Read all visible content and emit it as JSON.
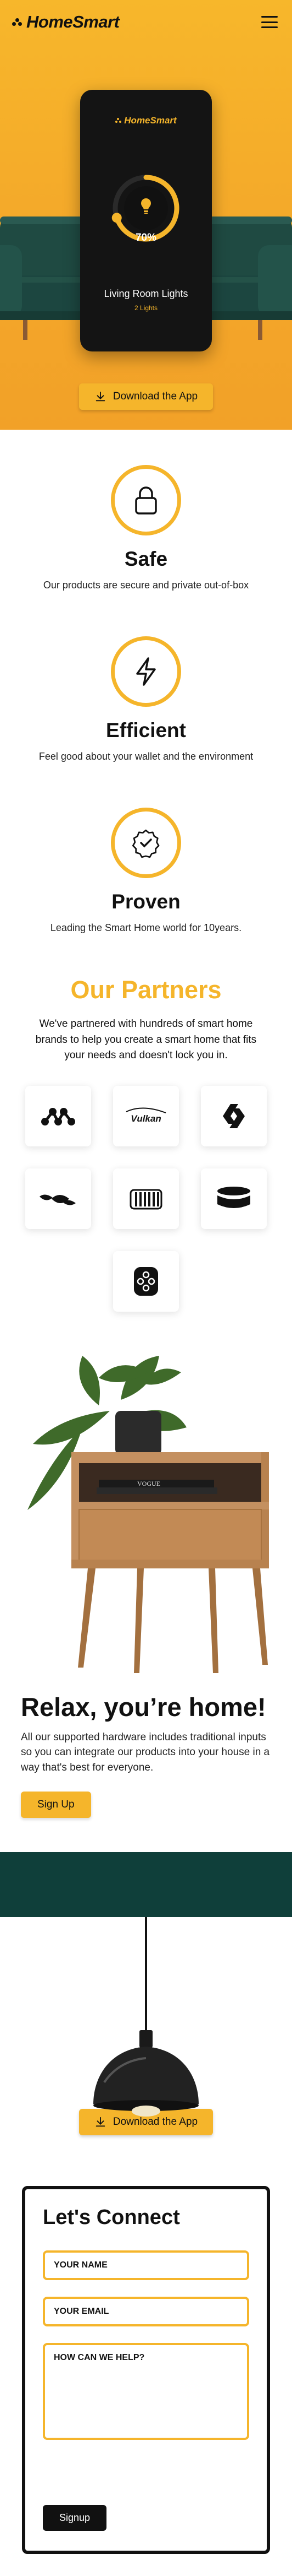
{
  "header": {
    "brand": "HomeSmart",
    "menu_icon": "hamburger-menu-icon"
  },
  "hero": {
    "phone_brand": "HomeSmart",
    "dial_percent": "70%",
    "dial_level": 0.7,
    "room_name": "Living Room Lights",
    "room_sub": "2 Lights"
  },
  "download": {
    "label": "Download the App",
    "icon": "download-icon"
  },
  "features": [
    {
      "title": "Safe",
      "desc": "Our products are secure and private out-of-box",
      "icon": "lock-icon"
    },
    {
      "title": "Efficient",
      "desc": "Feel good about your wallet and the environment",
      "icon": "lightning-icon"
    },
    {
      "title": "Proven",
      "desc": "Leading the Smart Home world for 10years.",
      "icon": "verified-badge-icon"
    }
  ],
  "partners": {
    "title": "Our Partners",
    "desc": "We've partnered with hundreds of smart home brands to help you create a smart home that fits your needs and doesn't lock you in.",
    "logos": [
      "Vulkan"
    ]
  },
  "relax": {
    "title": "Relax, you’re home!",
    "desc": "All our supported hardware includes traditional inputs so you can integrate our products into your house in a way that's best for everyone.",
    "signup": "Sign Up",
    "book_title": "VOGUE"
  },
  "connect": {
    "title": "Let's Connect",
    "name_placeholder": "YOUR NAME",
    "email_placeholder": "YOUR EMAIL",
    "message_placeholder": "HOW CAN WE HELP?",
    "submit": "Signup"
  },
  "colors": {
    "accent": "#f5b52b",
    "dark": "#111111",
    "teal": "#0f3f3a"
  }
}
